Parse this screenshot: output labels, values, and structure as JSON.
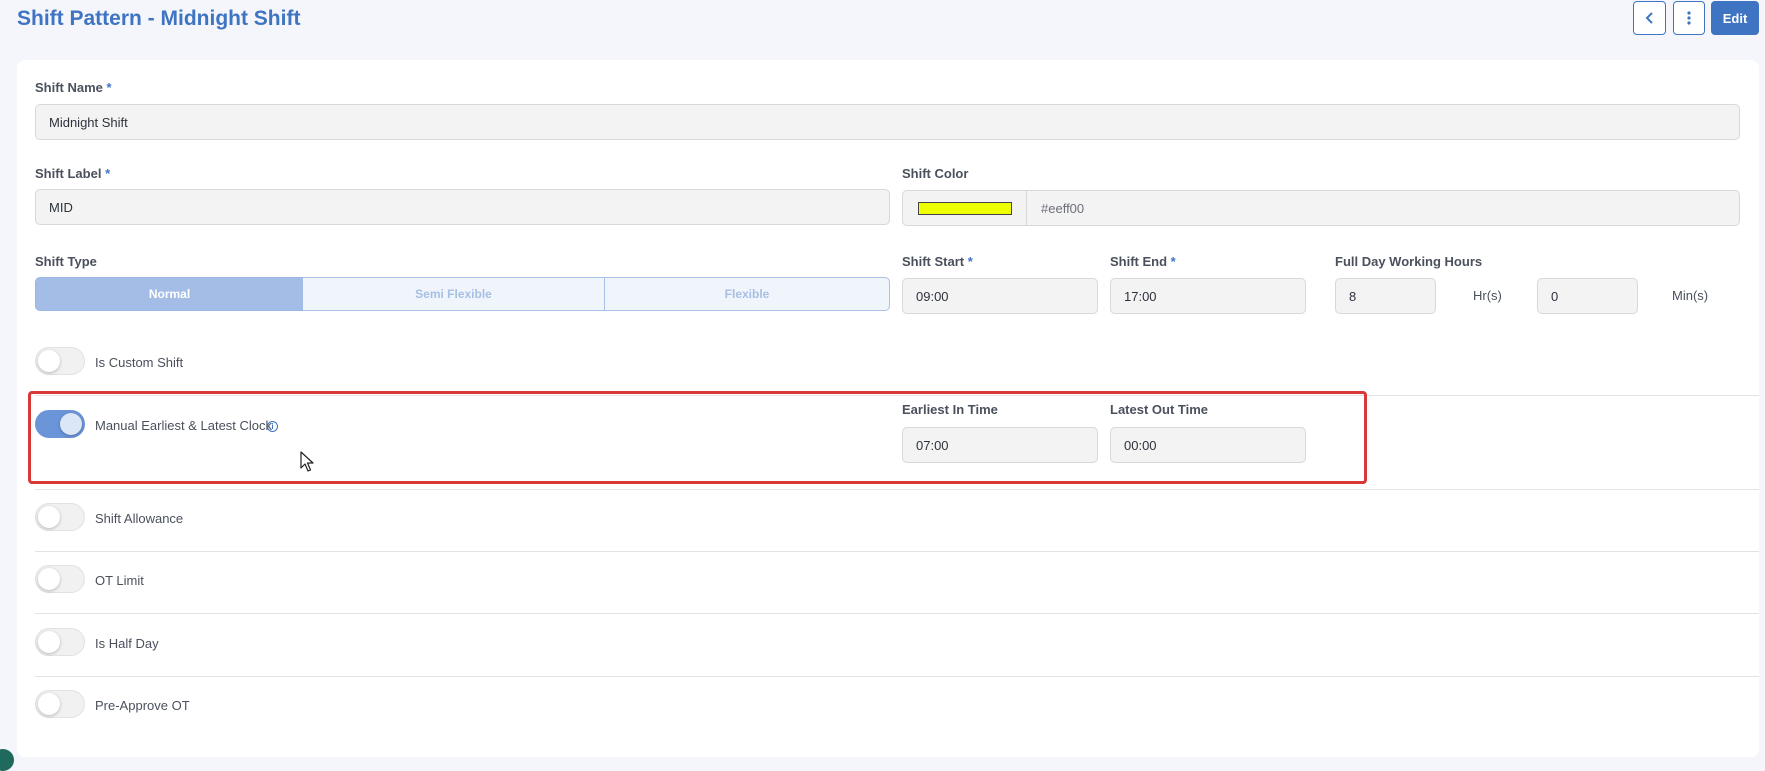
{
  "header": {
    "title": "Shift Pattern - Midnight Shift",
    "edit_label": "Edit"
  },
  "form": {
    "shift_name": {
      "label": "Shift Name",
      "required_mark": "*",
      "value": "Midnight Shift"
    },
    "shift_label": {
      "label": "Shift Label",
      "required_mark": "*",
      "value": "MID"
    },
    "shift_color": {
      "label": "Shift Color",
      "value": "#eeff00",
      "swatch": "#eeff00"
    },
    "shift_type": {
      "label": "Shift Type",
      "options": [
        "Normal",
        "Semi Flexible",
        "Flexible"
      ],
      "selected": "Normal"
    },
    "shift_start": {
      "label": "Shift Start",
      "required_mark": "*",
      "value": "09:00"
    },
    "shift_end": {
      "label": "Shift End",
      "required_mark": "*",
      "value": "17:00"
    },
    "full_day": {
      "label": "Full Day Working Hours",
      "hours": "8",
      "hours_unit": "Hr(s)",
      "minutes": "0",
      "minutes_unit": "Min(s)"
    }
  },
  "toggles": [
    {
      "label": "Is Custom Shift",
      "on": false
    },
    {
      "label": "Manual Earliest & Latest Clock",
      "on": true
    },
    {
      "label": "Shift Allowance",
      "on": false
    },
    {
      "label": "OT Limit",
      "on": false
    },
    {
      "label": "Is Half Day",
      "on": false
    },
    {
      "label": "Pre-Approve OT",
      "on": false
    }
  ],
  "clock": {
    "earliest_in": {
      "label": "Earliest In Time",
      "value": "07:00"
    },
    "latest_out": {
      "label": "Latest Out Time",
      "value": "00:00"
    }
  },
  "colors": {
    "accent": "#3f74c3",
    "highlight_border": "#d93838",
    "toggle_on": "#6a95d9"
  }
}
